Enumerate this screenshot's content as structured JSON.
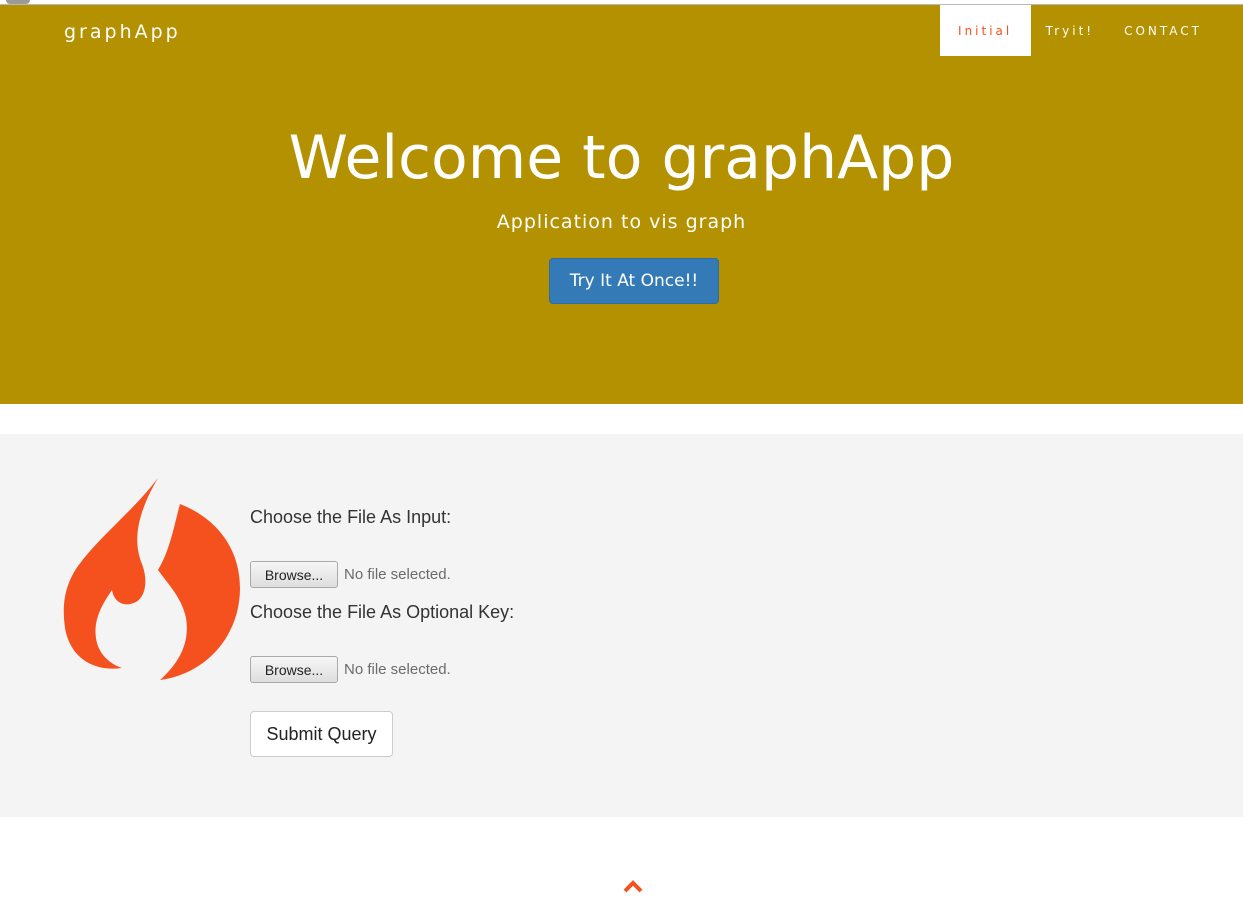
{
  "brand": "graphApp",
  "nav": {
    "items": [
      {
        "label": "Initial",
        "active": true
      },
      {
        "label": "Tryit!",
        "active": false
      },
      {
        "label": "CONTACT",
        "active": false
      }
    ]
  },
  "hero": {
    "title": "Welcome to graphApp",
    "subtitle": "Application to vis graph",
    "cta_label": "Try It At Once!!"
  },
  "upload": {
    "input_label": "Choose the File As Input:",
    "input_browse_label": "Browse...",
    "input_status": "No file selected.",
    "key_label": "Choose the File As Optional Key:",
    "key_browse_label": "Browse...",
    "key_status": "No file selected.",
    "submit_label": "Submit Query"
  },
  "icons": {
    "logo": "flame-icon",
    "back_to_top": "chevron-up-icon"
  },
  "colors": {
    "hero_bg": "#b39100",
    "accent": "#f4511e",
    "primary_button": "#337ab7",
    "section_bg": "#f4f4f4"
  }
}
